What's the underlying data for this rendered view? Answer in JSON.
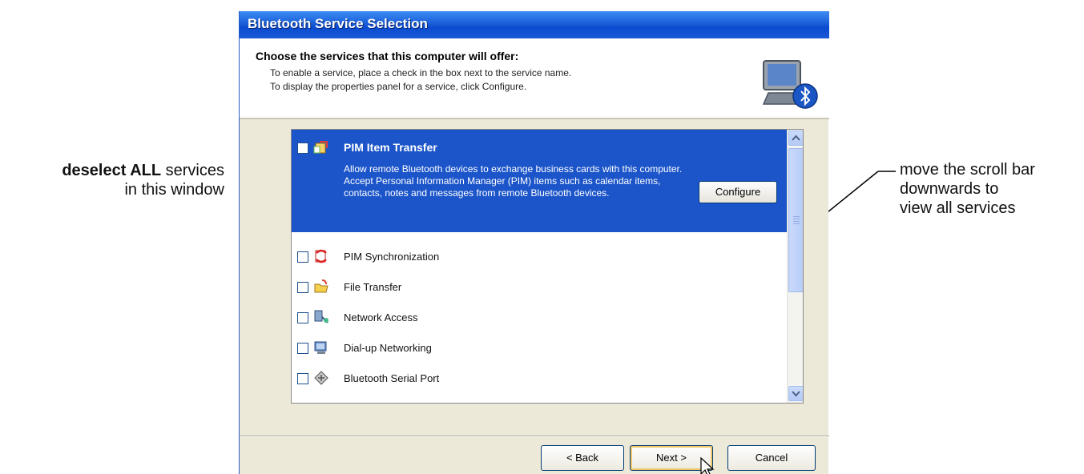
{
  "annotations": {
    "left_bold": "deselect ALL",
    "left_rest_1": " services",
    "left_line2": "in this window",
    "right_line1": "move the scroll bar",
    "right_line2": "downwards to",
    "right_line3": "view all services"
  },
  "window": {
    "title": "Bluetooth Service Selection",
    "header_title": "Choose the services that this computer will offer:",
    "header_line1": "To enable a service, place a check in the box next to the service name.",
    "header_line2": "To display the properties panel for a service, click Configure."
  },
  "services": {
    "selected": {
      "title": "PIM Item Transfer",
      "description": "Allow remote Bluetooth devices to exchange business cards with this computer. Accept Personal Information Manager (PIM) items such as calendar items, contacts, notes and messages from remote Bluetooth devices.",
      "configure_label": "Configure"
    },
    "items": [
      {
        "label": "PIM Synchronization"
      },
      {
        "label": "File Transfer"
      },
      {
        "label": "Network Access"
      },
      {
        "label": "Dial-up Networking"
      },
      {
        "label": "Bluetooth Serial Port"
      }
    ]
  },
  "buttons": {
    "back": "< Back",
    "next": "Next >",
    "cancel": "Cancel"
  },
  "colors": {
    "titlebar": "#0a4ad0",
    "selection": "#1c55c9",
    "dialog_bg": "#ece9d8"
  }
}
